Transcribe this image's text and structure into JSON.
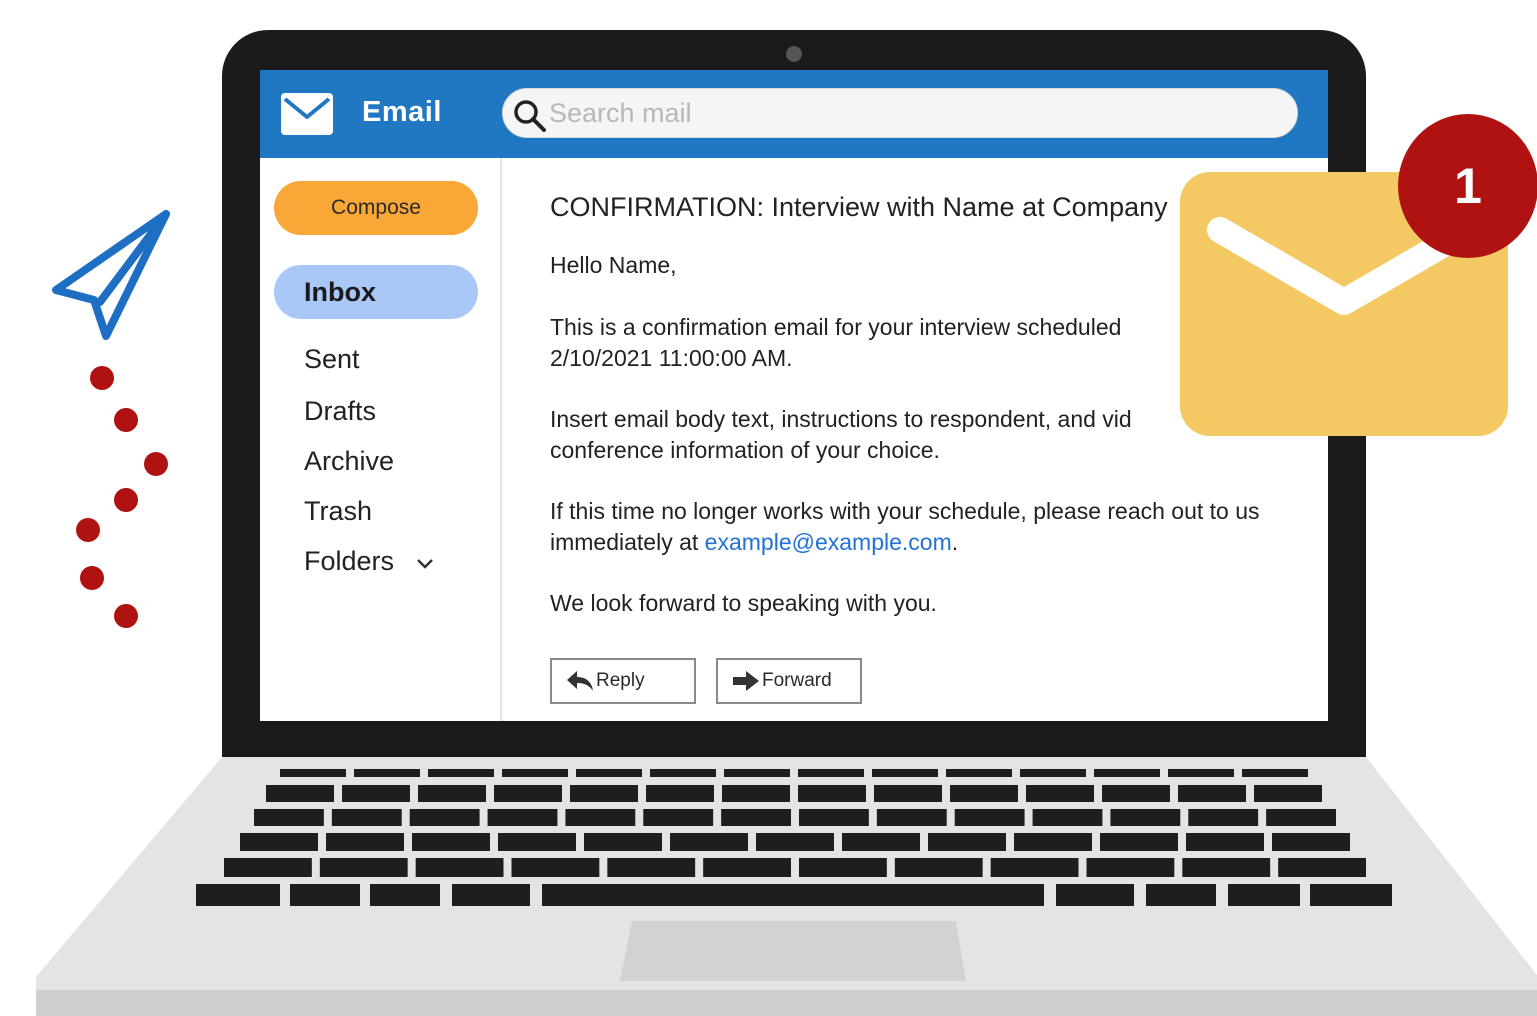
{
  "app": {
    "title": "Email",
    "search_placeholder": "Search mail"
  },
  "sidebar": {
    "compose_label": "Compose",
    "inbox_label": "Inbox",
    "items": [
      {
        "label": "Sent"
      },
      {
        "label": "Drafts"
      },
      {
        "label": "Archive"
      },
      {
        "label": "Trash"
      },
      {
        "label": "Folders"
      }
    ]
  },
  "message": {
    "subject": "CONFIRMATION: Interview with Name at Company",
    "greeting": "Hello Name,",
    "p1": "This is a confirmation email for your interview scheduled 2/10/2021 11:00:00 AM.",
    "p2": "Insert email body text, instructions to respondent, and vid conference information of your choice.",
    "p3_prefix": "If this time no longer works with your schedule, please reach out to us immediately at",
    "p3_email": "example@example.com",
    "p3_suffix": ".",
    "closing": "We look forward to speaking with you.",
    "reply_label": "Reply",
    "forward_label": "Forward"
  },
  "notification": {
    "count": "1"
  },
  "colors": {
    "topbar": "#1f78c1",
    "compose": "#f9a737",
    "inbox": "#a9c8f7",
    "badge": "#b01212",
    "envelope": "#f4c862",
    "link": "#2172d6"
  },
  "icons": [
    "mail-icon",
    "search-icon",
    "chevron-down-icon",
    "reply-arrow-icon",
    "forward-arrow-icon",
    "paper-plane-icon",
    "envelope-icon"
  ]
}
